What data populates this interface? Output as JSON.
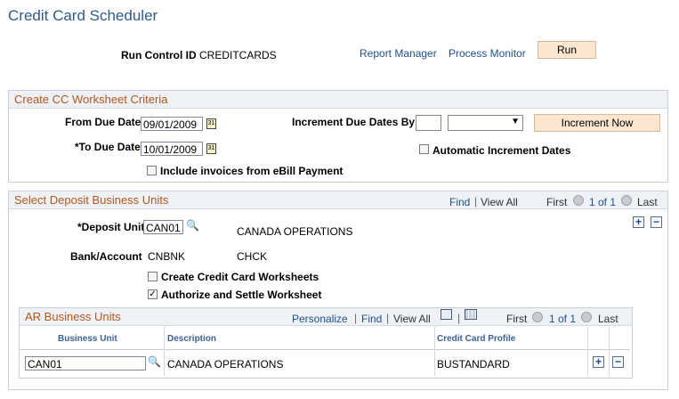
{
  "page": {
    "title": "Credit Card Scheduler"
  },
  "run_control": {
    "label": "Run Control ID",
    "value": "CREDITCARDS",
    "report_manager": "Report Manager",
    "process_monitor": "Process Monitor",
    "run_button": "Run"
  },
  "criteria": {
    "title": "Create CC Worksheet Criteria",
    "from_label": "From Due Date",
    "from_value": "09/01/2009",
    "to_label": "*To Due Date",
    "to_value": "10/01/2009",
    "increment_label": "Increment Due Dates By",
    "increment_value": "",
    "increment_unit": "",
    "increment_button": "Increment Now",
    "auto_increment_label": "Automatic Increment Dates",
    "ebill_label": "Include invoices from eBill Payment"
  },
  "deposit": {
    "title": "Select Deposit Business Units",
    "find": "Find",
    "view_all": "View All",
    "first": "First",
    "pager": "1 of 1",
    "last": "Last",
    "unit_label": "*Deposit Unit",
    "unit_value": "CAN01",
    "unit_desc": "CANADA OPERATIONS",
    "bank_label": "Bank/Account",
    "bank_value": "CNBNK",
    "account_value": "CHCK",
    "create_ws_label": "Create Credit Card Worksheets",
    "authorize_label": "Authorize and Settle Worksheet"
  },
  "ar": {
    "title": "AR Business Units",
    "personalize": "Personalize",
    "find": "Find",
    "view_all": "View All",
    "first": "First",
    "pager": "1 of 1",
    "last": "Last",
    "columns": [
      "Business Unit",
      "Description",
      "Credit Card Profile"
    ],
    "rows": [
      {
        "unit": "CAN01",
        "description": "CANADA OPERATIONS",
        "profile": "BUSTANDARD"
      }
    ]
  },
  "colors": {
    "title": "#2f5b8c",
    "group_title": "#b5561c",
    "link": "#1e4f8a",
    "button_bg": "#fde6d0"
  },
  "icons": {
    "lookup": "magnifier-icon",
    "calendar": "calendar-icon",
    "add": "plus-icon",
    "remove": "minus-icon"
  }
}
